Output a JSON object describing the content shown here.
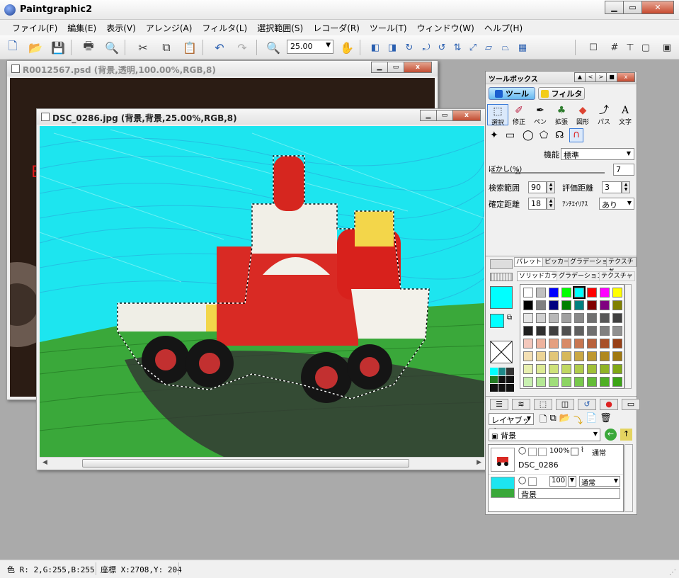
{
  "app": {
    "title": "Paintgraphic2"
  },
  "menu": [
    "ファイル(F)",
    "編集(E)",
    "表示(V)",
    "アレンジ(A)",
    "フィルタ(L)",
    "選択範囲(S)",
    "レコーダ(R)",
    "ツール(T)",
    "ウィンドウ(W)",
    "ヘルプ(H)"
  ],
  "toolbar": {
    "zoom_value": "25.00"
  },
  "windows": {
    "back": {
      "title": "R0012567.psd (背景,透明,100.00%,RGB,8)"
    },
    "front": {
      "title": "DSC_0286.jpg (背景,背景,25.00%,RGB,8)"
    }
  },
  "toolbox": {
    "title": "ツールボックス",
    "mode_tool": "ツール",
    "mode_filter": "フィルタ",
    "categories": [
      "選択",
      "修正",
      "ペン",
      "拡張",
      "図形",
      "パス",
      "文字"
    ],
    "function_label": "機能",
    "function_value": "標準",
    "blur_label": "ぼかし(%)",
    "blur_value": "7",
    "search_range_label": "検索範囲",
    "search_range_value": "90",
    "eval_distance_label": "評価距離",
    "eval_distance_value": "3",
    "confirm_distance_label": "確定距離",
    "confirm_distance_value": "18",
    "antialias_label": "ｱﾝﾁｴｲﾘｱｽ",
    "antialias_value": "あり"
  },
  "palette": {
    "tabs": [
      "パレット",
      "ピッカー",
      "グラデーション",
      "テクスチャ"
    ],
    "subtabs": [
      "ソリッドカラー",
      "グラデーション",
      "テクスチャ"
    ],
    "fg_color": "#00ffff",
    "bg_color": "#00ffff"
  },
  "layers": {
    "mode_select": "レイヤブック",
    "book_name": "背景",
    "items": [
      {
        "opacity": "100%",
        "blend": "通常",
        "name": "DSC_0286"
      },
      {
        "opacity": "100",
        "blend": "通常",
        "name": "背景"
      }
    ]
  },
  "status": {
    "color": "色 R:  2,G:255,B:255",
    "coords": "座標 X:2708,Y: 204"
  }
}
